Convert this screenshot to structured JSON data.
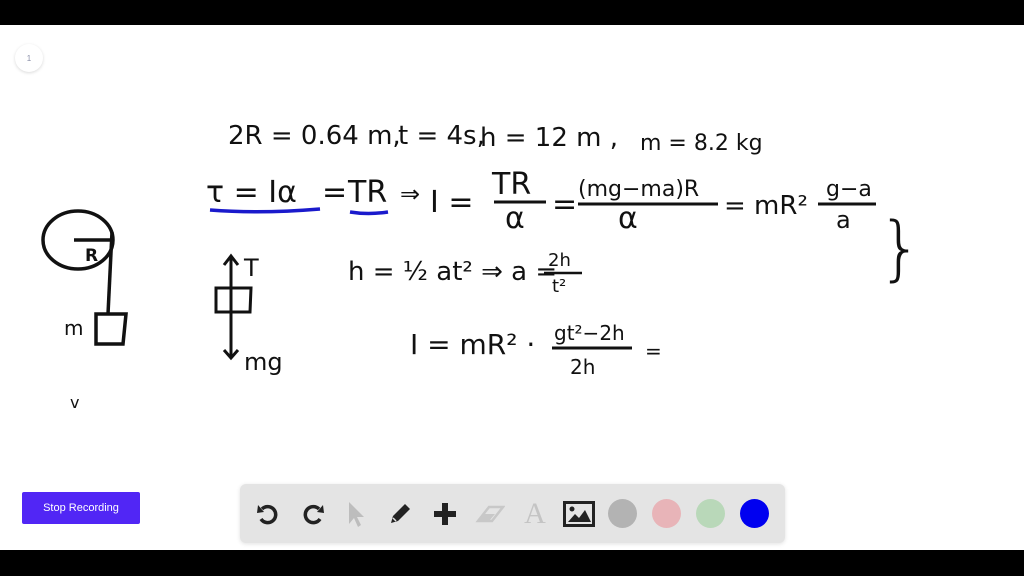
{
  "page": {
    "number": "1"
  },
  "recording": {
    "stop_label": "Stop Recording",
    "button_color": "#5126f5"
  },
  "toolbar": {
    "tools": [
      {
        "name": "undo",
        "icon": "undo-icon"
      },
      {
        "name": "redo",
        "icon": "redo-icon"
      },
      {
        "name": "select",
        "icon": "cursor-icon"
      },
      {
        "name": "pen",
        "icon": "pencil-icon"
      },
      {
        "name": "add",
        "icon": "plus-icon"
      },
      {
        "name": "eraser",
        "icon": "eraser-icon"
      },
      {
        "name": "text",
        "icon": "text-icon",
        "glyph": "A"
      },
      {
        "name": "image",
        "icon": "image-icon"
      }
    ],
    "colors": [
      {
        "name": "gray",
        "hex": "#b3b3b3"
      },
      {
        "name": "pink",
        "hex": "#e8b4b8"
      },
      {
        "name": "green",
        "hex": "#b9d8b9"
      },
      {
        "name": "blue",
        "hex": "#0000f0",
        "selected": true
      }
    ]
  },
  "board": {
    "line1": {
      "given_R": "2R = 0.64 m,",
      "given_t": "t = 4s,",
      "given_h": "h = 12 m ,",
      "given_m": "m = 8.2 kg"
    },
    "line2": {
      "torque": "τ = Iα",
      "eq": "=",
      "tr": "TR",
      "implies": "⇒",
      "I_eq": "I =",
      "frac1_num": "TR",
      "frac1_den": "α",
      "eq2": "=",
      "frac2_num": "(mg−ma)R",
      "frac2_den": "α",
      "eq3": "= mR²",
      "frac3_num": "g−a",
      "frac3_den": "a",
      "brace": "}"
    },
    "line3": {
      "kin": "h = ½ at² ⇒ a =",
      "frac_num": "2h",
      "frac_den": "t²"
    },
    "line4": {
      "lhs": "I = mR² ·",
      "frac_num": "gt²−2h",
      "frac_den": "2h",
      "trail": "="
    },
    "diagram": {
      "radius_label": "R",
      "mass_label": "m",
      "tension_label": "T",
      "weight_label": "mg",
      "stray_mark": "v"
    },
    "ink_underline_color": "#1a1acc"
  }
}
